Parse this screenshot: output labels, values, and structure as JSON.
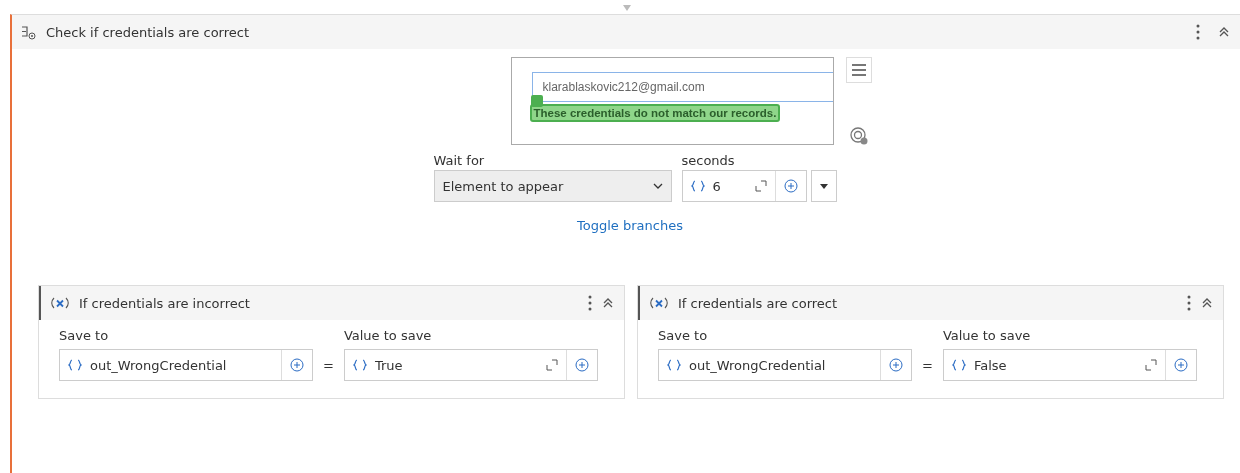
{
  "activity": {
    "title": "Check if credentials are correct"
  },
  "preview": {
    "email_value": "klarablaskovic212@gmail.com",
    "error_message": "These credentials do not match our records."
  },
  "wait_for": {
    "label": "Wait for",
    "value": "Element to appear"
  },
  "seconds": {
    "label": "seconds",
    "value": "6"
  },
  "toggle_link": "Toggle branches",
  "branches": [
    {
      "title": "If credentials are incorrect",
      "save_to_label": "Save to",
      "save_to_value": "out_WrongCredential",
      "equals": "=",
      "value_label": "Value to save",
      "value": "True"
    },
    {
      "title": "If credentials are correct",
      "save_to_label": "Save to",
      "save_to_value": "out_WrongCredential",
      "equals": "=",
      "value_label": "Value to save",
      "value": "False"
    }
  ]
}
